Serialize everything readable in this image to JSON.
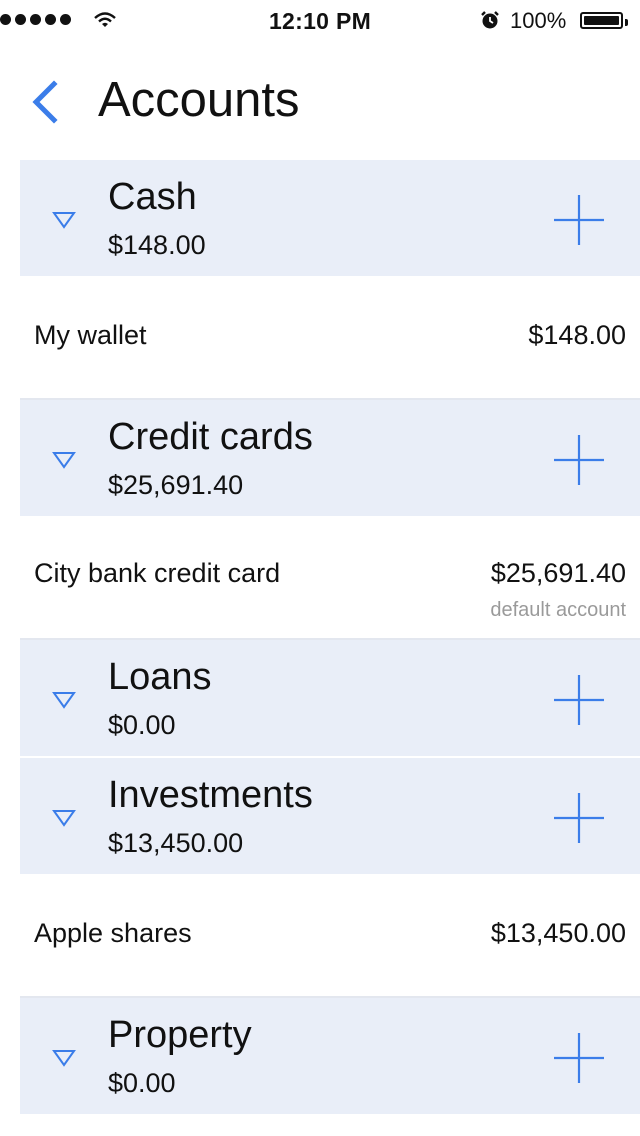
{
  "status_bar": {
    "time": "12:10 PM",
    "battery_percent": "100%",
    "icons": [
      "signal-dots-icon",
      "wifi-icon",
      "alarm-icon",
      "battery-icon"
    ]
  },
  "nav": {
    "title": "Accounts",
    "back_icon": "chevron-left-icon"
  },
  "colors": {
    "accent": "#3b7de9",
    "group_background": "#e9eef8",
    "muted_text": "#9a9a9a"
  },
  "groups": [
    {
      "name": "Cash",
      "total": "$148.00",
      "accounts": [
        {
          "name": "My wallet",
          "balance": "$148.00",
          "note": ""
        }
      ]
    },
    {
      "name": "Credit cards",
      "total": "$25,691.40",
      "accounts": [
        {
          "name": "City bank credit card",
          "balance": "$25,691.40",
          "note": "default account"
        }
      ]
    },
    {
      "name": "Loans",
      "total": "$0.00",
      "accounts": []
    },
    {
      "name": "Investments",
      "total": "$13,450.00",
      "accounts": [
        {
          "name": "Apple shares",
          "balance": "$13,450.00",
          "note": ""
        }
      ]
    },
    {
      "name": "Property",
      "total": "$0.00",
      "accounts": []
    }
  ]
}
